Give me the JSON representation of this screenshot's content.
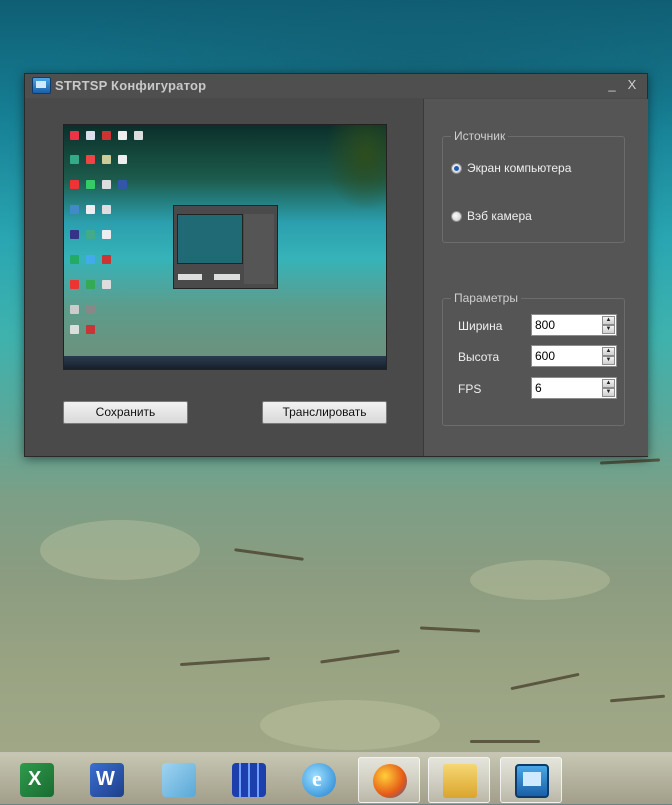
{
  "window": {
    "title": "STRTSP Конфигуратор",
    "minimize_glyph": "_",
    "close_glyph": "X"
  },
  "actions": {
    "save_label": "Сохранить",
    "stream_label": "Транслировать"
  },
  "source": {
    "group_label": "Источник",
    "options": [
      {
        "label": "Экран компьютера",
        "checked": true
      },
      {
        "label": "Вэб камера",
        "checked": false
      }
    ]
  },
  "params": {
    "group_label": "Параметры",
    "width": {
      "label": "Ширина",
      "value": "800"
    },
    "height": {
      "label": "Высота",
      "value": "600"
    },
    "fps": {
      "label": "FPS",
      "value": "6"
    }
  },
  "taskbar": {
    "items": [
      {
        "icon": "excel-icon"
      },
      {
        "icon": "word-icon"
      },
      {
        "icon": "notepad-icon"
      },
      {
        "icon": "server-icon"
      },
      {
        "icon": "internet-explorer-icon"
      },
      {
        "icon": "firefox-icon"
      },
      {
        "icon": "file-explorer-icon"
      },
      {
        "icon": "strtsp-icon"
      }
    ]
  },
  "colors": {
    "window_bg": "#4a4a4a",
    "panel_bg": "#555555",
    "radio_checked": "#1a5fb4"
  }
}
